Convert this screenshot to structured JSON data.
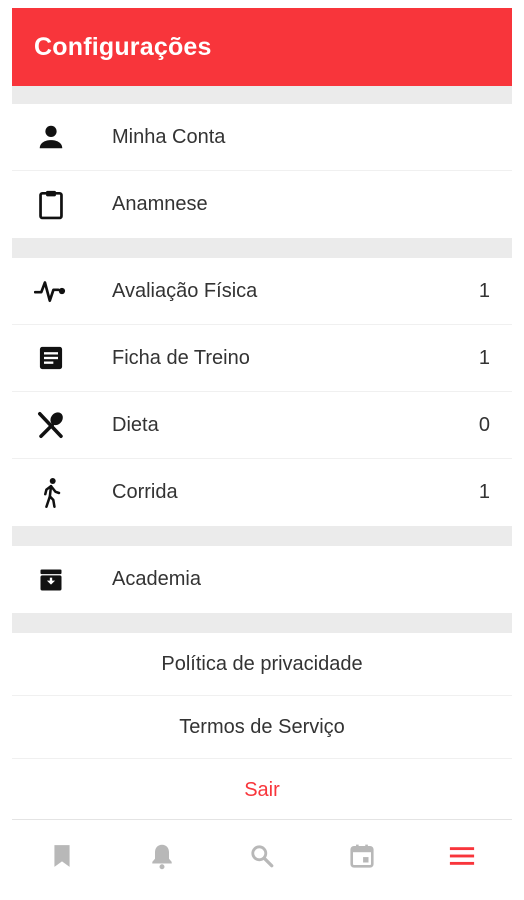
{
  "header": {
    "title": "Configurações",
    "color": "#f8353b"
  },
  "account_section": [
    {
      "label": "Minha Conta",
      "icon": "person-icon"
    },
    {
      "label": "Anamnese",
      "icon": "clipboard-icon"
    }
  ],
  "activity_section": [
    {
      "label": "Avaliação Física",
      "icon": "heartbeat-icon",
      "count": "1"
    },
    {
      "label": "Ficha de Treino",
      "icon": "document-icon",
      "count": "1"
    },
    {
      "label": "Dieta",
      "icon": "utensils-icon",
      "count": "0"
    },
    {
      "label": "Corrida",
      "icon": "walking-icon",
      "count": "1"
    }
  ],
  "gym_section": [
    {
      "label": "Academia",
      "icon": "archive-icon"
    }
  ],
  "links": {
    "privacy": "Política de privacidade",
    "terms": "Termos de Serviço",
    "logout": "Sair"
  },
  "bottom_nav": [
    {
      "icon": "bookmark-icon",
      "active": false
    },
    {
      "icon": "bell-icon",
      "active": false
    },
    {
      "icon": "search-icon",
      "active": false
    },
    {
      "icon": "calendar-icon",
      "active": false
    },
    {
      "icon": "menu-icon",
      "active": true
    }
  ],
  "colors": {
    "accent": "#f8353b",
    "inactive_icon": "#b8b8b8",
    "text": "#333333"
  }
}
